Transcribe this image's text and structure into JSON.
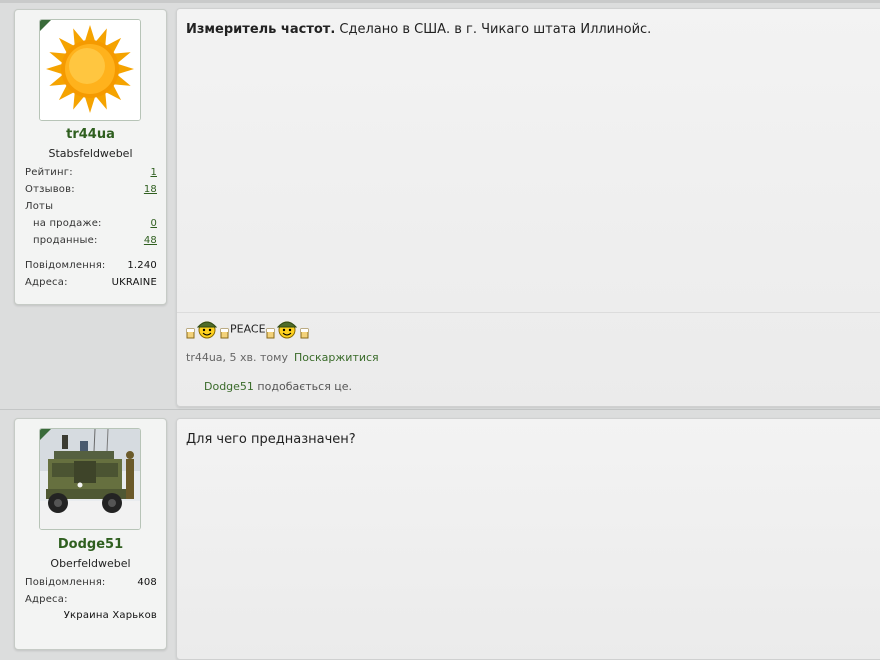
{
  "posts": [
    {
      "user": {
        "name": "tr44ua",
        "title": "Stabsfeldwebel",
        "stats": [
          {
            "label": "Рейтинг:",
            "value": "1"
          },
          {
            "label": "Отзывов:",
            "value": "18"
          },
          {
            "label": "Лоты",
            "value": ""
          },
          {
            "label": "на продаже:",
            "value": "0"
          },
          {
            "label": "проданные:",
            "value": "48"
          },
          {
            "label": "Повідомлення:",
            "value": "1.240"
          },
          {
            "label": "Адреса:",
            "value": "UKRAINE"
          }
        ],
        "avatar_icon": "sun-avatar"
      },
      "message": {
        "bold": "Измеритель частот.",
        "text": " Сделано в США. в г. Чикаго штата Иллинойс."
      },
      "signature": {
        "text": "PEACE",
        "icon": "smiley-soldier-beer-icon"
      },
      "meta": {
        "author": "tr44ua",
        "time": ", 5 хв. тому",
        "report": "Поскаржитися"
      },
      "likes": {
        "who": "Dodge51",
        "text": " подобається це."
      }
    },
    {
      "user": {
        "name": "Dodge51",
        "title": "Oberfeldwebel",
        "stats": [
          {
            "label": "Повідомлення:",
            "value": "408"
          },
          {
            "label": "Адреса:",
            "value": ""
          },
          {
            "label": "",
            "value": "Украина Харьков"
          }
        ],
        "avatar_icon": "military-truck-avatar"
      },
      "message": {
        "text": "Для чего предназначен?"
      }
    }
  ],
  "colors": {
    "username": "#2f5f1f",
    "link": "#3a6b2a",
    "corner": "#3a6b3a",
    "background": "#dcdddd"
  }
}
